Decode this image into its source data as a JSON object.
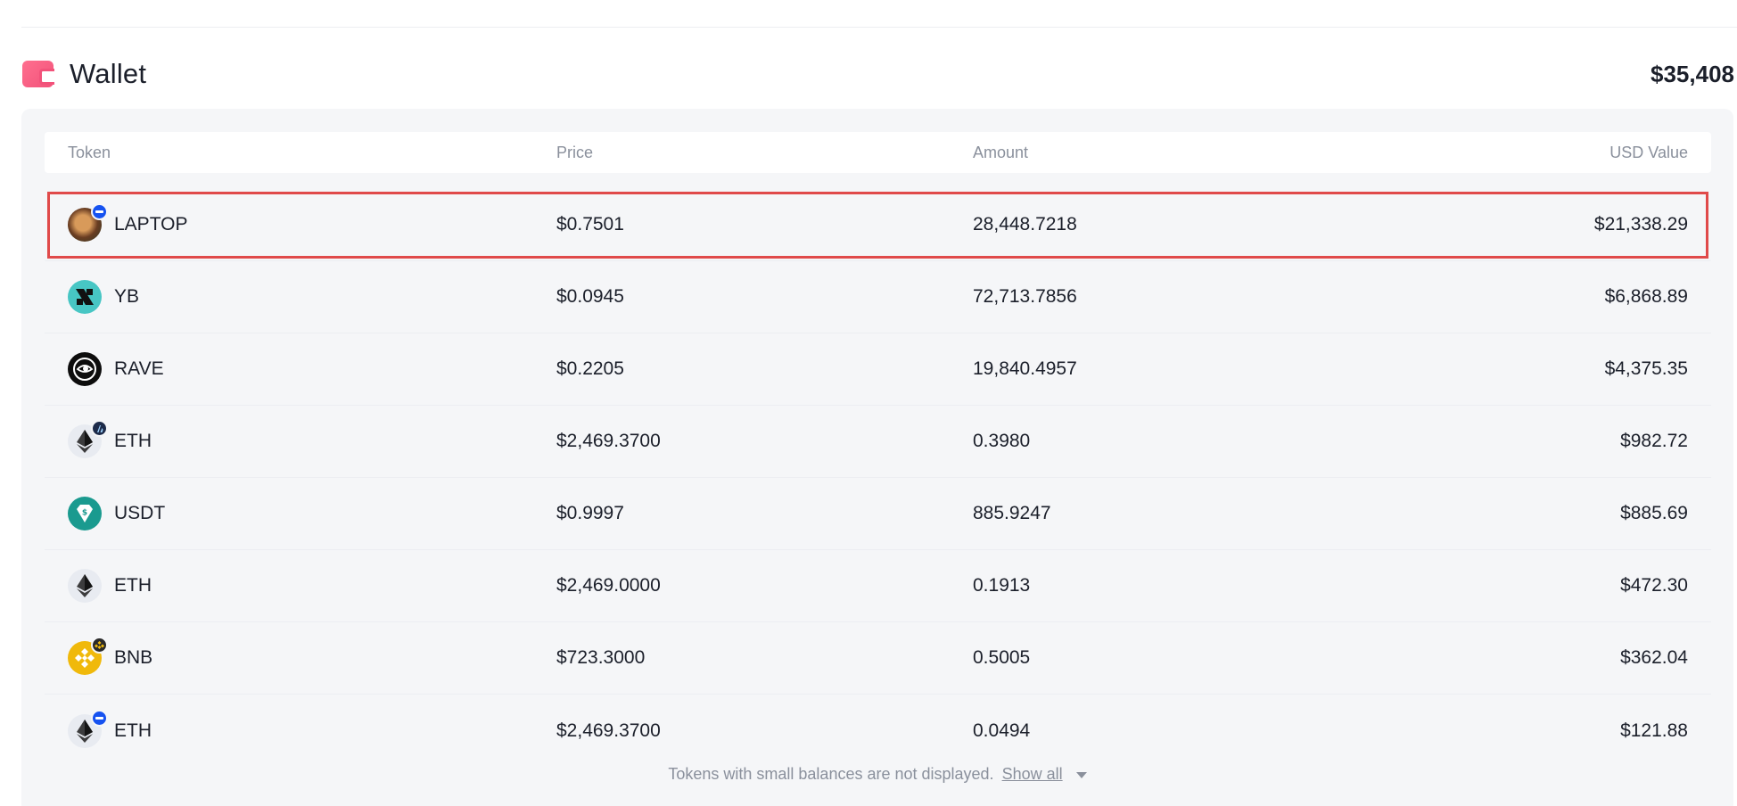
{
  "wallet": {
    "title": "Wallet",
    "total": "$35,408"
  },
  "table": {
    "headers": {
      "token": "Token",
      "price": "Price",
      "amount": "Amount",
      "usd_value": "USD Value"
    },
    "rows": [
      {
        "symbol": "LAPTOP",
        "price": "$0.7501",
        "amount": "28,448.7218",
        "usd_value": "$21,338.29",
        "icon": "laptop-token-icon",
        "chain_badge": "base-chain-badge-icon",
        "highlighted": true
      },
      {
        "symbol": "YB",
        "price": "$0.0945",
        "amount": "72,713.7856",
        "usd_value": "$6,868.89",
        "icon": "yb-token-icon"
      },
      {
        "symbol": "RAVE",
        "price": "$0.2205",
        "amount": "19,840.4957",
        "usd_value": "$4,375.35",
        "icon": "rave-token-icon"
      },
      {
        "symbol": "ETH",
        "price": "$2,469.3700",
        "amount": "0.3980",
        "usd_value": "$982.72",
        "icon": "eth-token-icon",
        "chain_badge": "arbitrum-chain-badge-icon"
      },
      {
        "symbol": "USDT",
        "price": "$0.9997",
        "amount": "885.9247",
        "usd_value": "$885.69",
        "icon": "usdt-token-icon"
      },
      {
        "symbol": "ETH",
        "price": "$2,469.0000",
        "amount": "0.1913",
        "usd_value": "$472.30",
        "icon": "eth-token-icon"
      },
      {
        "symbol": "BNB",
        "price": "$723.3000",
        "amount": "0.5005",
        "usd_value": "$362.04",
        "icon": "bnb-token-icon",
        "chain_badge": "bnb-chain-badge-icon"
      },
      {
        "symbol": "ETH",
        "price": "$2,469.3700",
        "amount": "0.0494",
        "usd_value": "$121.88",
        "icon": "eth-token-icon",
        "chain_badge": "base-chain-badge-icon"
      }
    ]
  },
  "footer": {
    "note": "Tokens with small balances are not displayed.",
    "show_all": "Show all"
  },
  "colors": {
    "highlight_outline": "#e04a4a",
    "panel_background": "#f5f6f8",
    "wallet_icon": "#f2527a"
  }
}
